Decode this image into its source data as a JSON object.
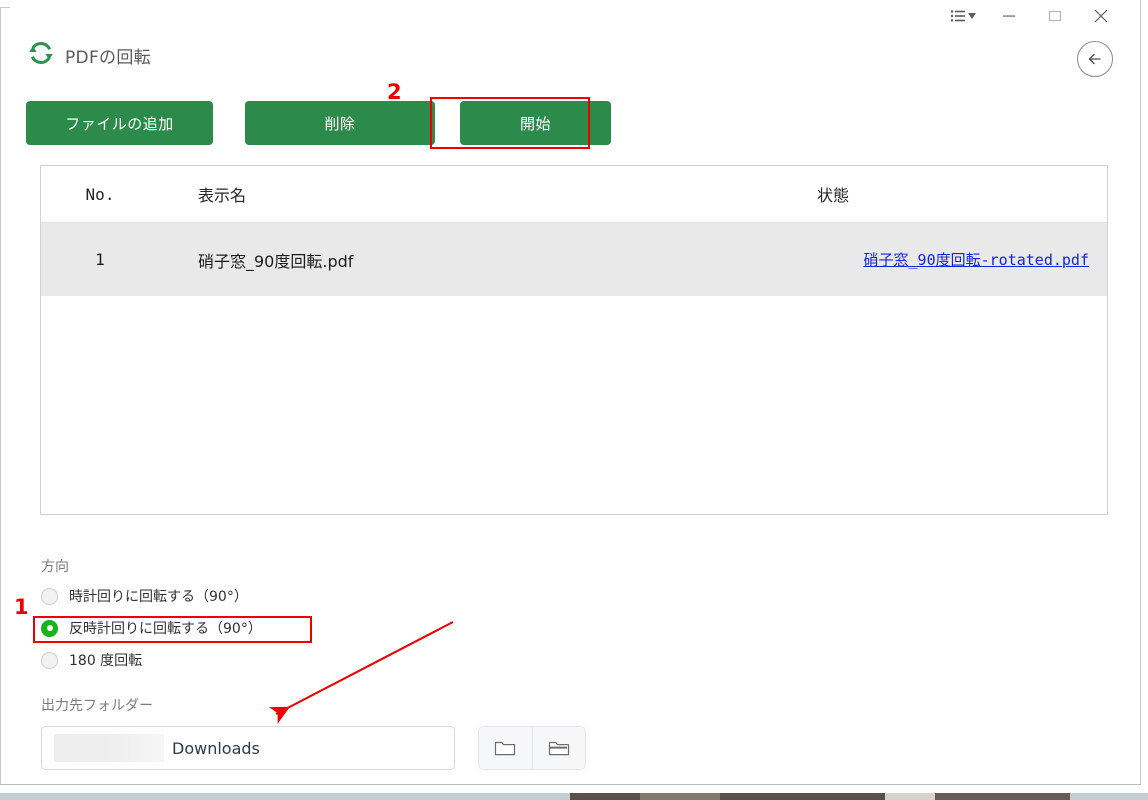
{
  "window": {
    "titlebar": {
      "menu_icon": "list-menu-icon",
      "minimize_label": "–",
      "maximize_label": "□",
      "close_label": "✕"
    }
  },
  "header": {
    "app_icon": "rotate-refresh-icon",
    "title": "PDFの回転",
    "back_button_icon": "back-arrow-icon"
  },
  "toolbar": {
    "add_file_label": "ファイルの追加",
    "delete_label": "削除",
    "start_label": "開始"
  },
  "annotations": {
    "step1": "1",
    "step2": "2",
    "arrow_color": "#ee0000",
    "box_color": "#ee0000"
  },
  "table": {
    "columns": [
      "No.",
      "表示名",
      "状態"
    ],
    "rows": [
      {
        "no": "1",
        "display_name": "硝子窓_90度回転.pdf",
        "state": "硝子窓_90度回転-rotated.pdf",
        "state_is_link": true
      }
    ]
  },
  "direction": {
    "group_label": "方向",
    "options": [
      {
        "label": "時計回りに回転する（90°）",
        "selected": false
      },
      {
        "label": "反時計回りに回転する（90°）",
        "selected": true
      },
      {
        "label": "180 度回転",
        "selected": false
      }
    ]
  },
  "output": {
    "label": "出力先フォルダー",
    "path_value": "Downloads",
    "path_prefix_redacted": true,
    "browse_icon": "folder-closed-icon",
    "open_icon": "folder-open-icon"
  },
  "colors": {
    "accent_green": "#2c8a4b",
    "radio_green": "#17b317",
    "link_blue": "#1423e0",
    "annotation_red": "#ee0000",
    "row_gray": "#e9e9e9"
  }
}
